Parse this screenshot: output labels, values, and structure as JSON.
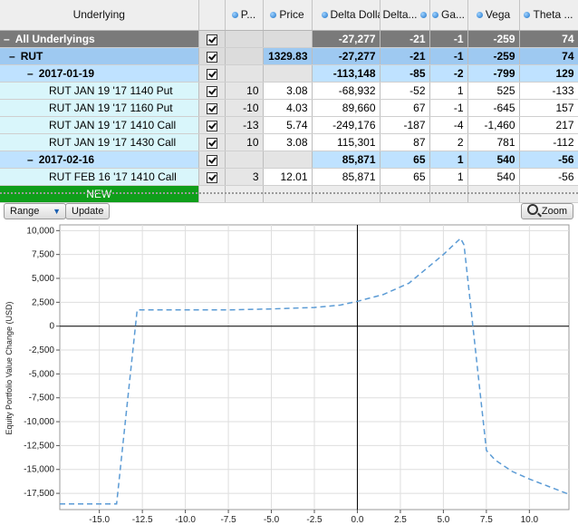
{
  "grid": {
    "columns": [
      "Underlying",
      "",
      "P...",
      "Price",
      "Delta Dollars",
      "Delta...",
      "Ga...",
      "Vega",
      "Theta ..."
    ],
    "rows": [
      {
        "type": "all",
        "name": "All Underlyings",
        "expander": "–",
        "pos": "",
        "price": "",
        "delta_dollars": "-27,277",
        "delta": "-21",
        "gamma": "-1",
        "vega": "-259",
        "theta": "74"
      },
      {
        "type": "underlying",
        "name": "RUT",
        "expander": "–",
        "pos": "",
        "price": "1329.83",
        "delta_dollars": "-27,277",
        "delta": "-21",
        "gamma": "-1",
        "vega": "-259",
        "theta": "74"
      },
      {
        "type": "expiry",
        "name": "2017-01-19",
        "expander": "–",
        "pos": "",
        "price": "",
        "delta_dollars": "-113,148",
        "delta": "-85",
        "gamma": "-2",
        "vega": "-799",
        "theta": "129"
      },
      {
        "type": "position",
        "name": "RUT JAN 19 '17 1140 Put",
        "pos": "10",
        "price": "3.08",
        "delta_dollars": "-68,932",
        "delta": "-52",
        "gamma": "1",
        "vega": "525",
        "theta": "-133"
      },
      {
        "type": "position",
        "name": "RUT JAN 19 '17 1160 Put",
        "pos": "-10",
        "price": "4.03",
        "delta_dollars": "89,660",
        "delta": "67",
        "gamma": "-1",
        "vega": "-645",
        "theta": "157"
      },
      {
        "type": "position",
        "name": "RUT JAN 19 '17 1410 Call",
        "pos": "-13",
        "price": "5.74",
        "delta_dollars": "-249,176",
        "delta": "-187",
        "gamma": "-4",
        "vega": "-1,460",
        "theta": "217"
      },
      {
        "type": "position",
        "name": "RUT JAN 19 '17 1430 Call",
        "pos": "10",
        "price": "3.08",
        "delta_dollars": "115,301",
        "delta": "87",
        "gamma": "2",
        "vega": "781",
        "theta": "-112"
      },
      {
        "type": "expiry",
        "name": "2017-02-16",
        "expander": "–",
        "pos": "",
        "price": "",
        "delta_dollars": "85,871",
        "delta": "65",
        "gamma": "1",
        "vega": "540",
        "theta": "-56"
      },
      {
        "type": "position",
        "name": "RUT FEB 16 '17 1410 Call",
        "pos": "3",
        "price": "12.01",
        "delta_dollars": "85,871",
        "delta": "65",
        "gamma": "1",
        "vega": "540",
        "theta": "-56"
      }
    ],
    "new_label": "NEW"
  },
  "toolbar": {
    "range_label": "Range",
    "range_arrow": "▼",
    "update_label": "Update",
    "zoom_label": "Zoom",
    "zoom_icon": "magnifier-icon"
  },
  "chart_data": {
    "type": "line",
    "ylabel": "Equity Portfolio Value Change (USD)",
    "xlabel": "",
    "xlim": [
      -17.3,
      12.3
    ],
    "ylim": [
      -19200,
      10600
    ],
    "x_ticks": [
      -15.0,
      -12.5,
      -10.0,
      -7.5,
      -5.0,
      -2.5,
      0.0,
      2.5,
      5.0,
      7.5,
      10.0
    ],
    "y_ticks": [
      -17500,
      -15000,
      -12500,
      -10000,
      -7500,
      -5000,
      -2500,
      0,
      2500,
      5000,
      7500,
      10000
    ],
    "grid": true,
    "line_color": "#5b9bd5",
    "line_style": "dashed",
    "zero_line": true,
    "x": [
      -17.3,
      -14.0,
      -12.8,
      -12.5,
      -7.5,
      -5.0,
      -2.5,
      -1.0,
      0.0,
      1.5,
      3.0,
      5.0,
      6.0,
      6.2,
      7.5,
      8.0,
      9.0,
      10.0,
      12.3
    ],
    "y": [
      -18600,
      -18600,
      1700,
      1700,
      1700,
      1800,
      1950,
      2200,
      2600,
      3300,
      4500,
      7500,
      9200,
      8500,
      -13000,
      -14000,
      -15200,
      -16000,
      -17600
    ]
  }
}
